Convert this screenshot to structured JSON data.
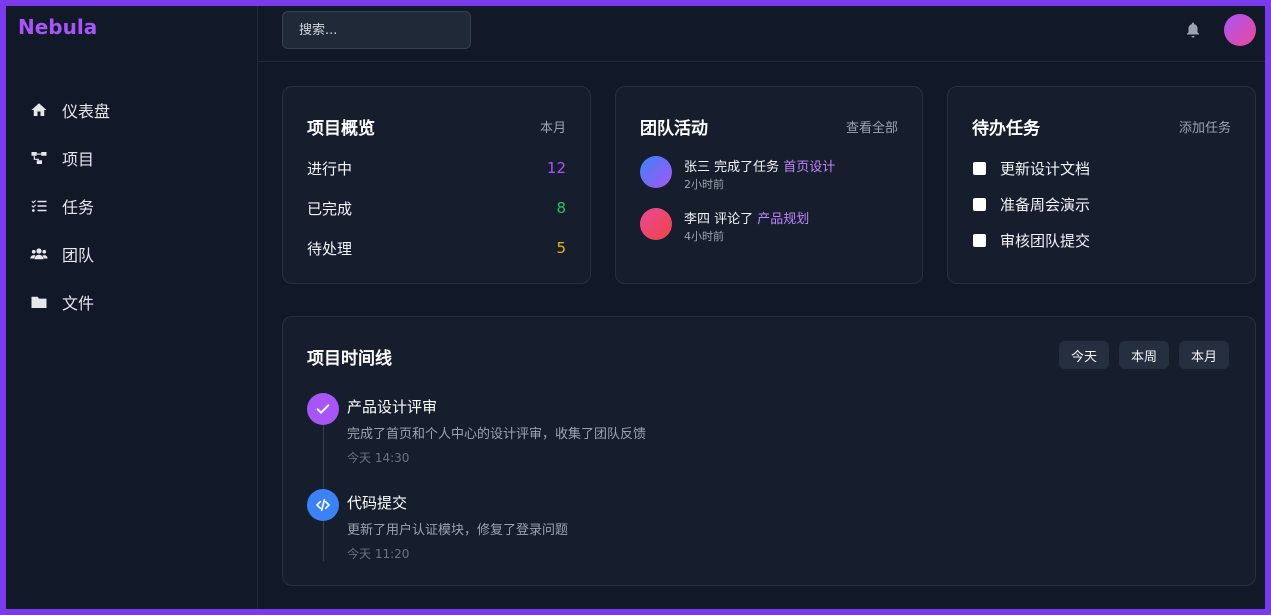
{
  "app": {
    "brand": "Nebula"
  },
  "sidebar": {
    "items": [
      {
        "label": "仪表盘",
        "icon": "home-icon"
      },
      {
        "label": "项目",
        "icon": "project-diagram-icon"
      },
      {
        "label": "任务",
        "icon": "tasks-icon"
      },
      {
        "label": "团队",
        "icon": "users-icon"
      },
      {
        "label": "文件",
        "icon": "folder-icon"
      }
    ]
  },
  "topbar": {
    "search_placeholder": "搜索...",
    "notification_icon": "bell-icon",
    "avatar_gradient": [
      "#a855f7",
      "#ec4899"
    ]
  },
  "overview": {
    "title": "项目概览",
    "action": "本月",
    "stats": [
      {
        "label": "进行中",
        "value": "12",
        "color": "#a855f7"
      },
      {
        "label": "已完成",
        "value": "8",
        "color": "#22c55e"
      },
      {
        "label": "待处理",
        "value": "5",
        "color": "#eab308"
      }
    ]
  },
  "activity": {
    "title": "团队活动",
    "action": "查看全部",
    "items": [
      {
        "text": "张三 完成了任务",
        "link": "首页设计",
        "time": "2小时前",
        "avatar_colors": [
          "#3b82f6",
          "#a855f7"
        ]
      },
      {
        "text": "李四 评论了",
        "link": "产品规划",
        "time": "4小时前",
        "avatar_colors": [
          "#ec4899",
          "#ef4444"
        ]
      }
    ]
  },
  "todos": {
    "title": "待办任务",
    "action": "添加任务",
    "items": [
      {
        "label": "更新设计文档",
        "checked": false
      },
      {
        "label": "准备周会演示",
        "checked": false
      },
      {
        "label": "审核团队提交",
        "checked": false
      }
    ]
  },
  "timeline": {
    "title": "项目时间线",
    "filters": [
      "今天",
      "本周",
      "本月"
    ],
    "events": [
      {
        "title": "产品设计评审",
        "desc": "完成了首页和个人中心的设计评审，收集了团队反馈",
        "time": "今天 14:30",
        "icon": "check-icon",
        "color": "#a855f7"
      },
      {
        "title": "代码提交",
        "desc": "更新了用户认证模块，修复了登录问题",
        "time": "今天 11:20",
        "icon": "code-icon",
        "color": "#3b82f6"
      }
    ]
  }
}
